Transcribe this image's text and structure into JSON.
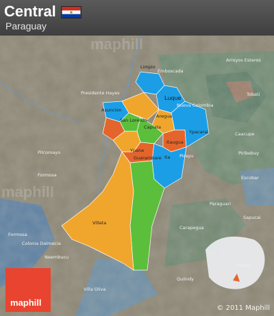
{
  "header": {
    "title": "Central",
    "subtitle": "Paraguay"
  },
  "colors": {
    "orange": "#f0a62c",
    "blue": "#1c9ee6",
    "green": "#5bbf3c",
    "red": "#e3652c",
    "terrain": "#8a8272",
    "water": "#5b7fa3",
    "logo": "#e8442f"
  },
  "watermark": {
    "top_text": "maphill",
    "left_text": "maphill"
  },
  "region_labels": {
    "limpio": "Limpio",
    "luque": "Luque",
    "asuncion": "Asuncion",
    "san_lorenzo": "San Lorenzo",
    "aregua": "Aregua",
    "capiata": "Capiata",
    "itaugua": "Itaugua",
    "ypacarai": "Ypacarai",
    "ypane": "Ypane",
    "guarambare": "Guarambare",
    "ita": "Ita",
    "villeta": "Villeta"
  },
  "place_labels": {
    "presidente_hayes": "Presidente Hayes",
    "pilcomayo": "Pilcomayo",
    "formosa": "Formosa",
    "formosa2": "Formosa",
    "colonia_dalmacia": "Colonia Dalmacia",
    "neembucu": "Neembucu",
    "villa_oliva": "Villa Oliva",
    "quiindy": "Quiindy",
    "carapegua": "Carapegua",
    "paraguari": "Paraguari",
    "pirayu": "Pirayu",
    "escobar": "Escobar",
    "sapucai": "Sapucai",
    "piribebuy": "Piribebuy",
    "caacupe": "Caacupe",
    "tobati": "Tobati",
    "arroyos_esteros": "Arroyos Esteros",
    "emboscada": "Emboscada",
    "nueva_colombia": "Nueva Colombia",
    "ybycui": "Ybycui"
  },
  "logo_text": "maphill",
  "copyright": "© 2011 Maphill"
}
